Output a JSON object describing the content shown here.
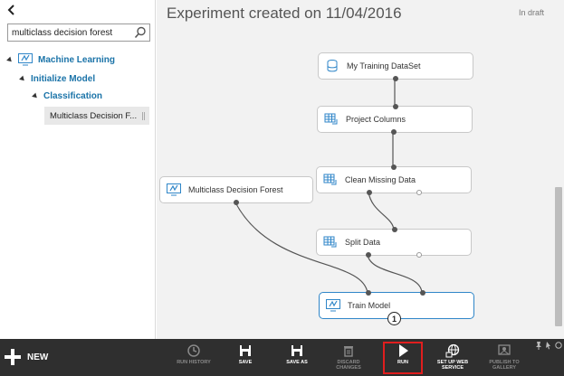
{
  "sidebar": {
    "search_value": "multiclass decision forest",
    "tree": {
      "machine_learning": "Machine Learning",
      "initialize_model": "Initialize Model",
      "classification": "Classification",
      "result": "Multiclass Decision F..."
    }
  },
  "canvas": {
    "title": "Experiment created on 11/04/2016",
    "status": "In draft",
    "modules": {
      "training_dataset": "My Training DataSet",
      "project_columns": "Project Columns",
      "clean_missing": "Clean Missing Data",
      "decision_forest": "Multiclass Decision Forest",
      "split_data": "Split Data",
      "train_model": "Train Model"
    },
    "train_badge": "1"
  },
  "toolbar": {
    "new_label": "NEW",
    "run_history": "RUN HISTORY",
    "save": "SAVE",
    "save_as": "SAVE AS",
    "discard_changes": "DISCARD CHANGES",
    "run": "RUN",
    "set_up_web_service_1": "SET UP WEB",
    "set_up_web_service_2": "SERVICE",
    "publish_1": "PUBLISH TO",
    "publish_2": "GALLERY"
  },
  "colors": {
    "accent": "#2f86c8",
    "link": "#1a73a8",
    "toolbar_bg": "#2f2f2f",
    "run_highlight": "#e01e1e"
  },
  "icons": {
    "back": "chevron-left-icon",
    "search": "search-icon",
    "dataset": "dataset-icon",
    "module": "module-grid-icon",
    "model": "model-icon"
  }
}
